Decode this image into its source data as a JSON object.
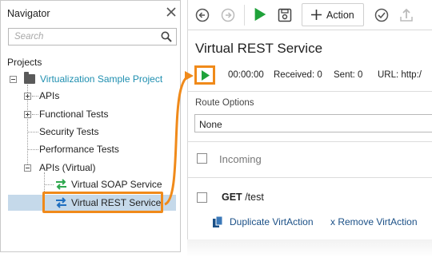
{
  "navigator": {
    "title": "Navigator",
    "search": {
      "placeholder": "Search"
    },
    "projects_label": "Projects",
    "project": {
      "name": "Virtualization Sample Project",
      "items": [
        {
          "label": "APIs"
        },
        {
          "label": "Functional Tests"
        },
        {
          "label": "Security Tests"
        },
        {
          "label": "Performance Tests"
        },
        {
          "label": "APIs (Virtual)"
        },
        {
          "label": "Virtual SOAP Service"
        },
        {
          "label": "Virtual REST Service"
        }
      ]
    }
  },
  "toolbar": {
    "action_label": "Action"
  },
  "editor": {
    "title": "Virtual REST Service",
    "status": {
      "time": "00:00:00",
      "received": "Received: 0",
      "sent": "Sent: 0",
      "url": "URL: http:/"
    },
    "route_options": {
      "label": "Route Options",
      "value": "None"
    },
    "incoming_label": "Incoming",
    "action": {
      "method": "GET",
      "path": "/test",
      "duplicate_label": "Duplicate VirtAction",
      "remove_label": "x Remove VirtAction"
    }
  },
  "colors": {
    "accent_orange": "#f08a1a",
    "selection": "#c5d9ea",
    "play_green": "#1fa23a",
    "project_teal": "#1f8fb0",
    "link_blue": "#1a4f86"
  }
}
